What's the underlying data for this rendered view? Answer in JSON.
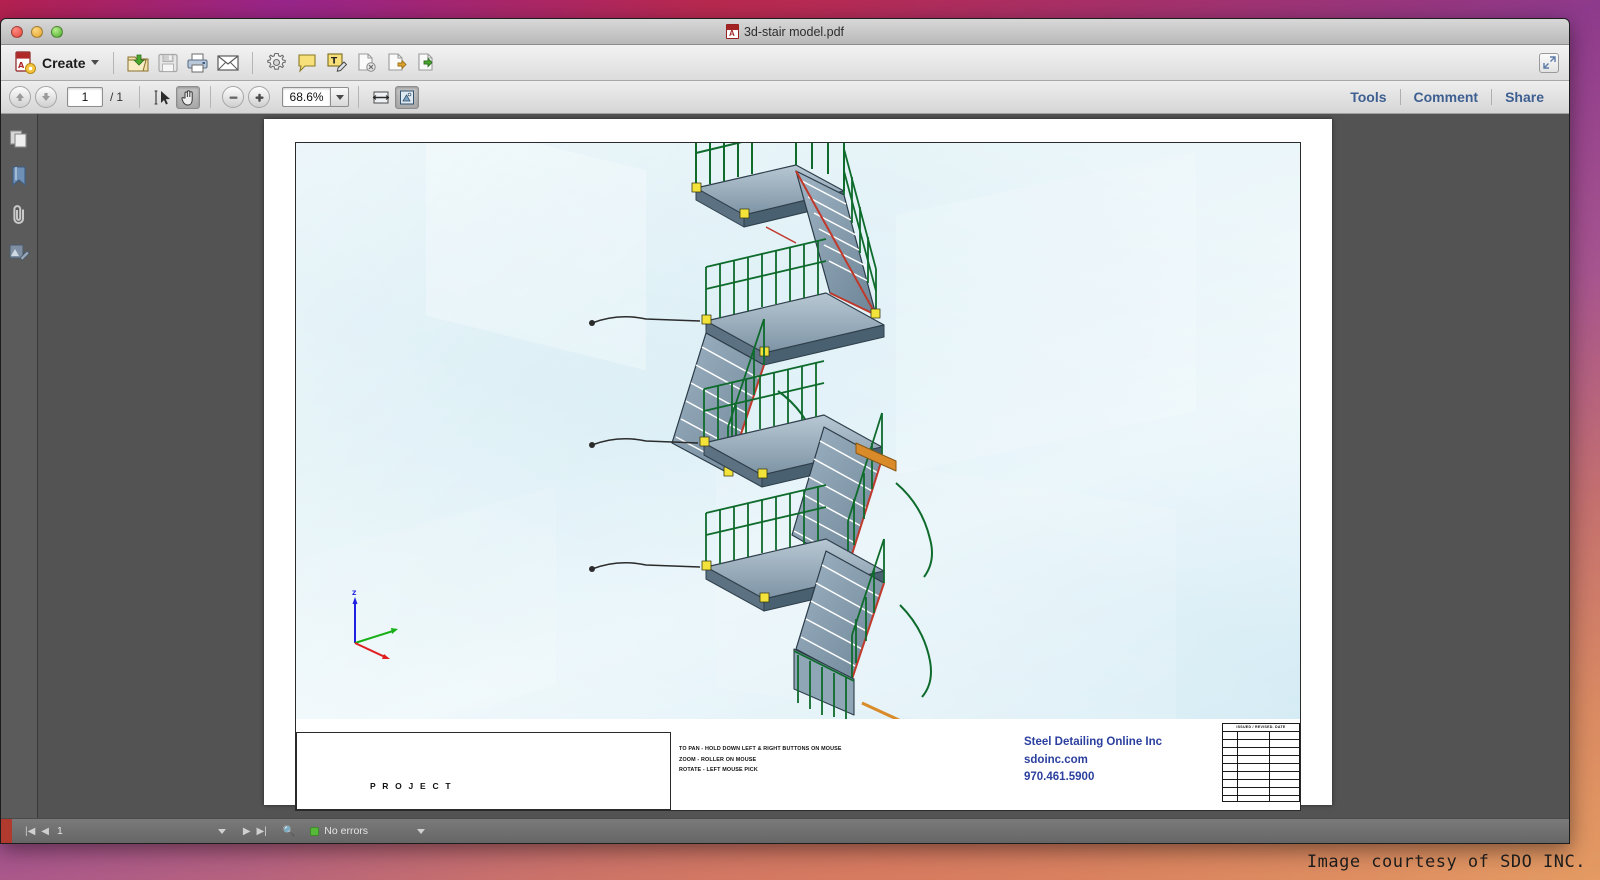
{
  "window": {
    "title": "3d-stair model.pdf",
    "file_icon": "pdf-file-icon"
  },
  "toolbar": {
    "create_label": "Create",
    "icons": [
      {
        "name": "open-folder-icon",
        "label": "Open"
      },
      {
        "name": "save-icon",
        "label": "Save"
      },
      {
        "name": "print-icon",
        "label": "Print"
      },
      {
        "name": "email-icon",
        "label": "Email"
      },
      {
        "name": "settings-gear-icon",
        "label": "Settings"
      },
      {
        "name": "sticky-note-icon",
        "label": "Add Sticky Note"
      },
      {
        "name": "highlight-text-icon",
        "label": "Highlight Text"
      },
      {
        "name": "page-delete-icon",
        "label": "Delete Pages"
      },
      {
        "name": "page-extract-icon",
        "label": "Extract Pages"
      },
      {
        "name": "page-insert-icon",
        "label": "Insert Pages"
      }
    ],
    "expand_icon": "expand-arrows-icon"
  },
  "navbar": {
    "prev_icon": "arrow-up-circle-icon",
    "next_icon": "arrow-down-circle-icon",
    "page_current": "1",
    "page_separator": "/",
    "page_total": "1",
    "select_tool_icon": "text-select-cursor-icon",
    "hand_tool_icon": "hand-pan-icon",
    "zoom_out_icon": "minus-circle-icon",
    "zoom_in_icon": "plus-circle-icon",
    "zoom_value": "68.6%",
    "zoom_dropdown_icon": "chevron-down-icon",
    "fit_width_icon": "fit-width-icon",
    "fit_page_icon": "fit-page-icon",
    "links": [
      "Tools",
      "Comment",
      "Share"
    ]
  },
  "sidebar": {
    "items": [
      {
        "name": "page-thumbnails-icon",
        "label": "Page Thumbnails"
      },
      {
        "name": "bookmarks-icon",
        "label": "Bookmarks"
      },
      {
        "name": "attachments-paperclip-icon",
        "label": "Attachments"
      },
      {
        "name": "model-tree-icon",
        "label": "Model Tree"
      }
    ]
  },
  "drawing": {
    "axis": {
      "z_label": "Z",
      "x_color": "#e02020",
      "y_color": "#16b016",
      "z_color": "#2020e0"
    },
    "project_label": "P R O J E C T",
    "instructions": [
      "TO PAN - HOLD DOWN LEFT & RIGHT BUTTONS ON MOUSE",
      "ZOOM - ROLLER ON MOUSE",
      "ROTATE - LEFT MOUSE PICK"
    ],
    "company": {
      "name": "Steel Detailing Online Inc",
      "website": "sdoinc.com",
      "phone": "970.461.5900",
      "color": "#2b3f9e"
    },
    "revision_table": {
      "header": "ISSUED / REVISED.  DATE",
      "row_count": 9
    }
  },
  "statusbar": {
    "first_icon": "go-first-icon",
    "prev_icon": "go-previous-icon",
    "page": "1",
    "dropdown_icon": "chevron-down-icon",
    "next_icon": "go-next-icon",
    "last_icon": "go-last-icon",
    "search_icon": "search-errors-icon",
    "status_text": "No errors",
    "status_color": "#57b83a",
    "menu_icon": "chevron-down-small-icon"
  },
  "watermark": {
    "text": "Image courtesy of SDO INC."
  }
}
